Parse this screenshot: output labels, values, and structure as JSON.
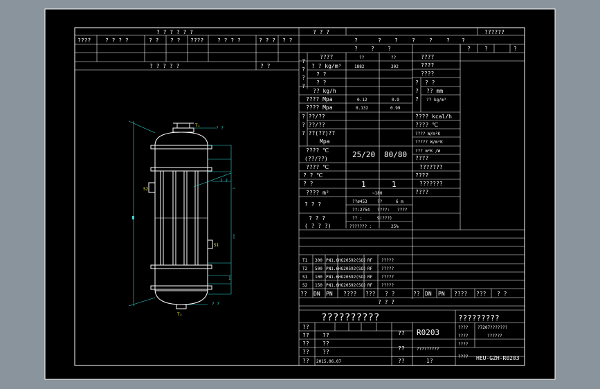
{
  "title_block": {
    "drawing_title": "??????????",
    "drawing_code": "R0203",
    "company": "?????????",
    "standard": "?7207???????",
    "tertiary": "??????",
    "drawing_no": "HEU-GZH-R0203",
    "scale": "1?",
    "date": "2015.06.07",
    "signoff_labels": [
      "??",
      "??",
      "??",
      "??",
      "??"
    ],
    "signoff_values": [
      "??",
      "??",
      "??",
      "??"
    ],
    "material_label": "?????????",
    "row_labels": [
      "????",
      "????",
      "????"
    ]
  },
  "header": {
    "left_title": "? ? ? ? ? ?",
    "left_cols": [
      "????",
      "? ? ? ?",
      "? ?",
      "? ?",
      "????",
      "? ? ? ?",
      "? ? ?",
      "? ?"
    ],
    "mid_title": "? ? ?",
    "mid_cols": [
      "?",
      "?",
      "?",
      "?",
      "?",
      "?",
      "?"
    ],
    "right_title": "??????",
    "left_subtitle": "? ? ? ? ?",
    "left_subtitle_right": "? ?"
  },
  "parameters": {
    "head_cols": [
      "?",
      "?",
      "?"
    ],
    "right_head_cols": [
      "?",
      "?",
      "?"
    ],
    "rows": [
      {
        "label": "????",
        "v1": "??",
        "v2": "??"
      },
      {
        "label": "? ? kg/m³",
        "v1": "1882",
        "v2": "302"
      },
      {
        "label": "? ?",
        "v1": "",
        "v2": ""
      },
      {
        "label": "? ?",
        "v1": "",
        "v2": ""
      },
      {
        "label": "?? kg/h",
        "v1": "",
        "v2": ""
      },
      {
        "label": "???? Mpa",
        "v1": "0.12",
        "v2": "0.9"
      },
      {
        "label": "???? Mpa",
        "v1": "0.132",
        "v2": "0.99"
      },
      {
        "label": "? ??/??",
        "v1": "",
        "v2": ""
      },
      {
        "label": "? ??/??",
        "v1": "",
        "v2": ""
      },
      {
        "label": "? ??(??)??",
        "v1": "",
        "v2": ""
      },
      {
        "label": "Mpa",
        "v1": "",
        "v2": ""
      },
      {
        "label": "???? ℃",
        "v1": "25/20",
        "v2": "80/80"
      },
      {
        "label": "(??/??)",
        "v1": "",
        "v2": ""
      },
      {
        "label": "???? ℃",
        "v1": "",
        "v2": ""
      },
      {
        "label": "? ? ℃",
        "v1": "",
        "v2": ""
      },
      {
        "label": "? ?",
        "v1": "1",
        "v2": "1"
      },
      {
        "label": "???? m²",
        "v1": "~180",
        "v2": ""
      }
    ],
    "side_labels": [
      "?",
      "?",
      "?",
      "?"
    ],
    "tube_block_label": "? ? ?",
    "tube_spec": [
      {
        "k": "??ø453",
        "v1": "??",
        "v2": "6 m"
      },
      {
        "k": "??:2754",
        "v1": "????:",
        "v2": "????"
      },
      {
        "k": "?? ;",
        "v1": "9(???)",
        "v2": ""
      },
      {
        "k": "???????  :",
        "v1": "25%",
        "v2": ""
      }
    ],
    "other_label_1": "? ? ?",
    "other_label_2": "( ? ? ?)",
    "right_rows": [
      "????",
      "????",
      "????",
      "? ?",
      "?? mm",
      "?? kg/m³",
      "???? kcal/h",
      "???? ℃",
      "???? W/m²K",
      "????? W/m²K",
      "??? m²K /W",
      "????",
      "???????",
      "????",
      "???????",
      "????"
    ],
    "right_side_labels": [
      "?",
      "?",
      "?"
    ]
  },
  "nozzles": {
    "headers": [
      "??",
      "DN",
      "PN",
      "????",
      "???",
      "? ?"
    ],
    "rows": [
      {
        "id": "T1",
        "dn": "300",
        "pn": "PN1.6",
        "std": "HG20592(SO)",
        "face": "RF",
        "use": "?????"
      },
      {
        "id": "T2",
        "dn": "500",
        "pn": "PN1.6",
        "std": "HG20592(SO)",
        "face": "RF",
        "use": "?????"
      },
      {
        "id": "S1",
        "dn": "100",
        "pn": "PN1.6",
        "std": "HG20592(SO)",
        "face": "RF",
        "use": "?????"
      },
      {
        "id": "S2",
        "dn": "150",
        "pn": "PN1.6",
        "std": "HG20592(SO)",
        "face": "RF",
        "use": "?????"
      }
    ],
    "right_headers": [
      "??",
      "DN",
      "PN",
      "????",
      "???",
      "? ?"
    ],
    "bottom_caption": "? ? ?"
  },
  "drawing": {
    "top_nozzle": "T₁",
    "bottom_nozzle": "T₂",
    "left_nozzle": "S2",
    "right_nozzle": "S1",
    "top_label": "? ?",
    "bottom_label": "? ?",
    "mid_label": "? ?",
    "dim_mark": "1"
  },
  "colors": {
    "canvas": "#000000",
    "frame": "#ffffff",
    "annotation": "#33d9d9",
    "background": "#8a949c"
  }
}
